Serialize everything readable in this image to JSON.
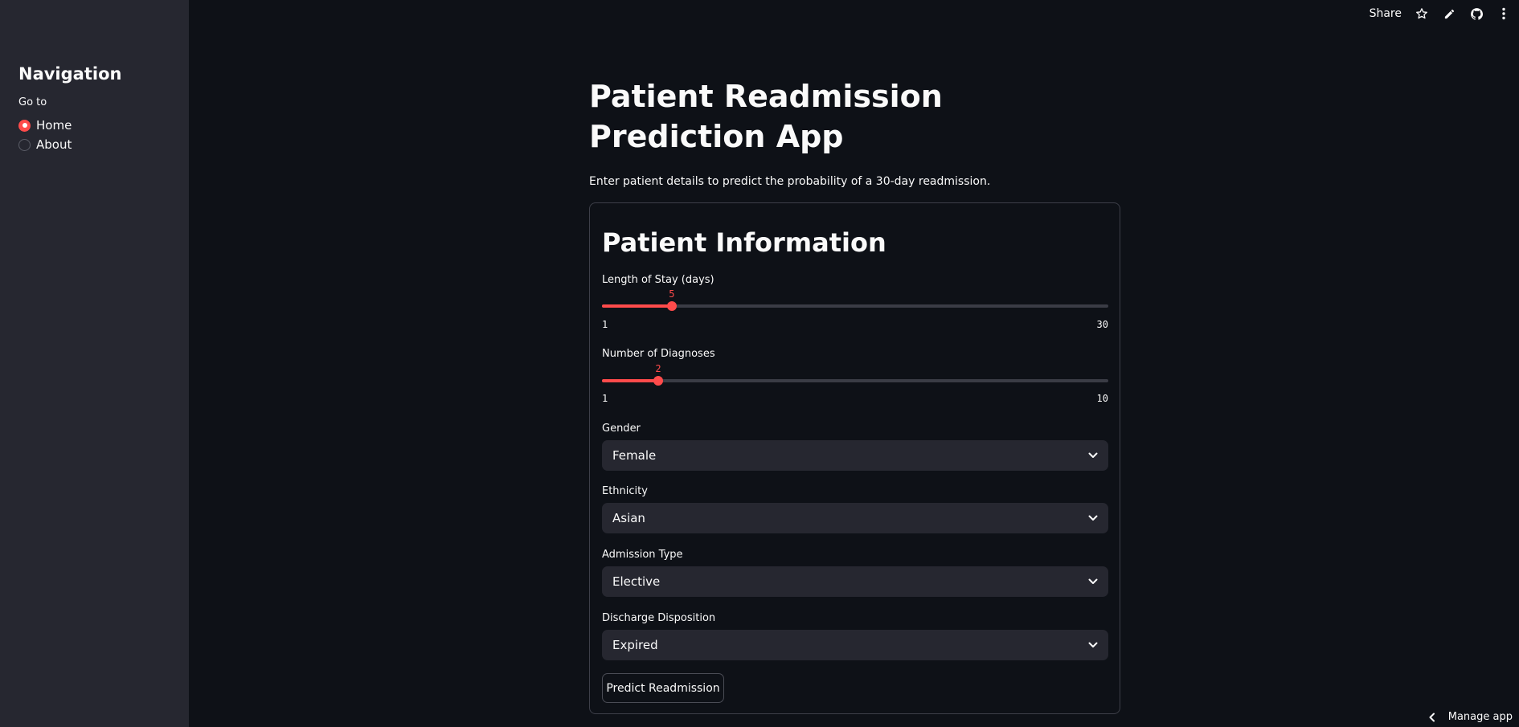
{
  "sidebar": {
    "title": "Navigation",
    "radio_label": "Go to",
    "options": [
      {
        "label": "Home",
        "selected": true
      },
      {
        "label": "About",
        "selected": false
      }
    ]
  },
  "toolbar": {
    "share_label": "Share",
    "icons": [
      "star-icon",
      "edit-icon",
      "github-icon",
      "more-icon"
    ]
  },
  "main": {
    "title": "Patient Readmission Prediction App",
    "subtitle": "Enter patient details to predict the probability of a 30-day readmission."
  },
  "form": {
    "header": "Patient Information",
    "length_of_stay": {
      "label": "Length of Stay (days)",
      "value": 5,
      "min": 1,
      "max": 30,
      "min_label": "1",
      "max_label": "30",
      "value_label": "5"
    },
    "num_diagnoses": {
      "label": "Number of Diagnoses",
      "value": 2,
      "min": 1,
      "max": 10,
      "min_label": "1",
      "max_label": "10",
      "value_label": "2"
    },
    "gender": {
      "label": "Gender",
      "value": "Female"
    },
    "ethnicity": {
      "label": "Ethnicity",
      "value": "Asian"
    },
    "admission_type": {
      "label": "Admission Type",
      "value": "Elective"
    },
    "discharge": {
      "label": "Discharge Disposition",
      "value": "Expired"
    },
    "submit_label": "Predict Readmission"
  },
  "footer": {
    "manage_label": "Manage app"
  },
  "colors": {
    "accent": "#ff4b4b",
    "background": "#0e1117",
    "sidebar": "#262730"
  }
}
